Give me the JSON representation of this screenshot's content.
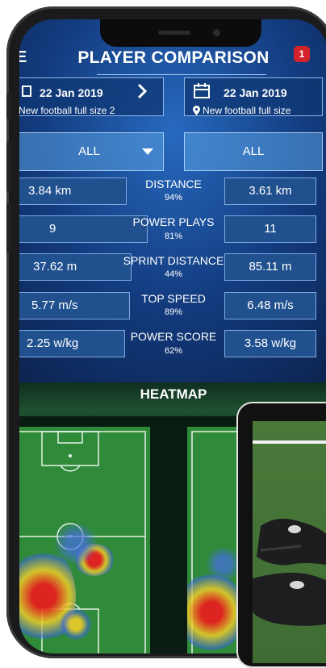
{
  "header": {
    "title": "PLAYER COMPARISON",
    "menu_glyph": "E",
    "notification_count": "1"
  },
  "sessions": [
    {
      "date": "22 Jan 2019",
      "venue": "New football full size 2",
      "icon": "calendar-icon"
    },
    {
      "date": "22 Jan 2019",
      "venue": "New football full size",
      "icon": "calendar-icon"
    }
  ],
  "filters": [
    {
      "label": "ALL"
    },
    {
      "label": "ALL"
    }
  ],
  "stats": [
    {
      "label": "DISTANCE",
      "percent": "94%",
      "left": "3.84 km",
      "right": "3.61 km"
    },
    {
      "label": "POWER PLAYS",
      "percent": "81%",
      "left": "9",
      "right": "11"
    },
    {
      "label": "SPRINT DISTANCE",
      "percent": "44%",
      "left": "37.62 m",
      "right": "85.11 m"
    },
    {
      "label": "TOP SPEED",
      "percent": "89%",
      "left": "5.77 m/s",
      "right": "6.48 m/s"
    },
    {
      "label": "POWER SCORE",
      "percent": "62%",
      "left": "2.25 w/kg",
      "right": "3.58 w/kg"
    }
  ],
  "heatmap": {
    "title": "HEATMAP"
  },
  "colors": {
    "accent": "#21508f",
    "notification": "#d3222a",
    "pitch": "#2f8b3a"
  }
}
